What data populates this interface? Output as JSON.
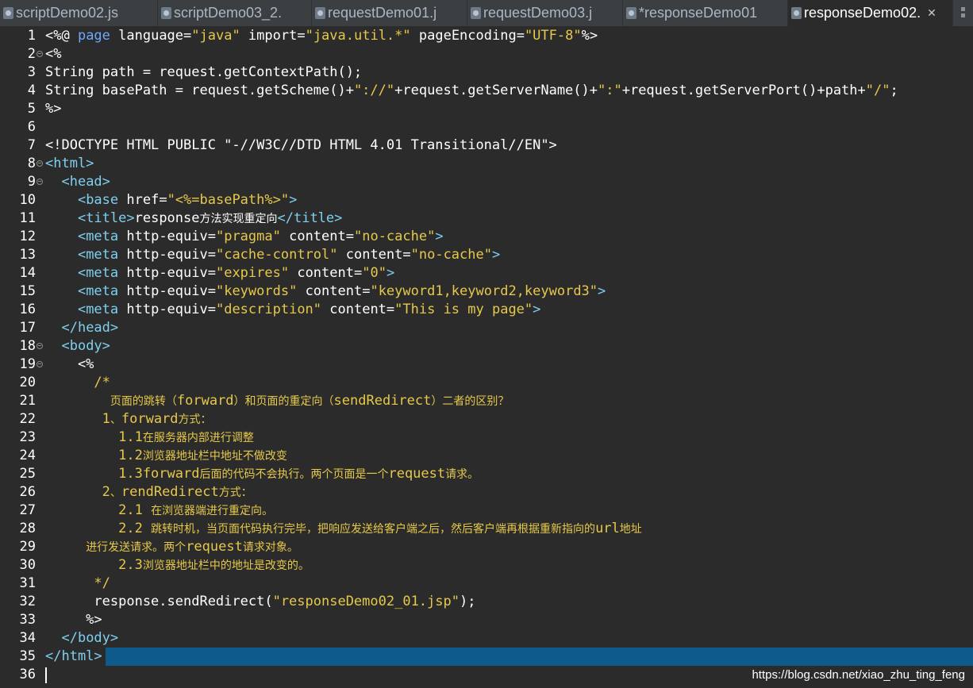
{
  "tabs": [
    {
      "label": "scriptDemo02.js",
      "active": false
    },
    {
      "label": "scriptDemo03_2.",
      "active": false
    },
    {
      "label": "requestDemo01.j",
      "active": false
    },
    {
      "label": "requestDemo03.j",
      "active": false
    },
    {
      "label": "*responseDemo01",
      "active": false
    },
    {
      "label": "responseDemo02.",
      "active": true
    }
  ],
  "close_symbol": "✕",
  "lines": [
    {
      "n": "1",
      "fold": false,
      "segs": [
        [
          "def",
          "<%@ "
        ],
        [
          "kw",
          "page"
        ],
        [
          "def",
          " language="
        ],
        [
          "str",
          "\"java\""
        ],
        [
          "def",
          " import="
        ],
        [
          "str",
          "\"java.util.*\""
        ],
        [
          "def",
          " pageEncoding="
        ],
        [
          "str",
          "\"UTF-8\""
        ],
        [
          "def",
          "%>"
        ]
      ]
    },
    {
      "n": "2",
      "fold": true,
      "segs": [
        [
          "def",
          "<%"
        ]
      ]
    },
    {
      "n": "3",
      "fold": false,
      "segs": [
        [
          "def",
          "String path = request.getContextPath();"
        ]
      ]
    },
    {
      "n": "4",
      "fold": false,
      "segs": [
        [
          "def",
          "String basePath = request.getScheme()+"
        ],
        [
          "str",
          "\"://\""
        ],
        [
          "def",
          "+request.getServerName()+"
        ],
        [
          "str",
          "\":\""
        ],
        [
          "def",
          "+request.getServerPort()+path+"
        ],
        [
          "str",
          "\"/\""
        ],
        [
          "def",
          ";"
        ]
      ]
    },
    {
      "n": "5",
      "fold": false,
      "segs": [
        [
          "def",
          "%>"
        ]
      ]
    },
    {
      "n": "6",
      "fold": false,
      "segs": []
    },
    {
      "n": "7",
      "fold": false,
      "segs": [
        [
          "def",
          "<!DOCTYPE HTML PUBLIC \"-//W3C//DTD HTML 4.01 Transitional//EN\">"
        ]
      ]
    },
    {
      "n": "8",
      "fold": true,
      "segs": [
        [
          "tag",
          "<html>"
        ]
      ]
    },
    {
      "n": "9",
      "fold": true,
      "segs": [
        [
          "def",
          "  "
        ],
        [
          "tag",
          "<head>"
        ]
      ]
    },
    {
      "n": "10",
      "fold": false,
      "segs": [
        [
          "def",
          "    "
        ],
        [
          "tag",
          "<base"
        ],
        [
          "attr",
          " href="
        ],
        [
          "str",
          "\"<%=basePath%>\""
        ],
        [
          "tag",
          ">"
        ]
      ]
    },
    {
      "n": "11",
      "fold": false,
      "segs": [
        [
          "def",
          "    "
        ],
        [
          "tag",
          "<title>"
        ],
        [
          "def",
          "response"
        ],
        [
          "cjk",
          "方法实现重定向"
        ],
        [
          "tag",
          "</title>"
        ]
      ]
    },
    {
      "n": "12",
      "fold": false,
      "segs": [
        [
          "def",
          "    "
        ],
        [
          "tag",
          "<meta"
        ],
        [
          "attr",
          " http-equiv="
        ],
        [
          "str",
          "\"pragma\""
        ],
        [
          "attr",
          " content="
        ],
        [
          "str",
          "\"no-cache\""
        ],
        [
          "tag",
          ">"
        ]
      ]
    },
    {
      "n": "13",
      "fold": false,
      "segs": [
        [
          "def",
          "    "
        ],
        [
          "tag",
          "<meta"
        ],
        [
          "attr",
          " http-equiv="
        ],
        [
          "str",
          "\"cache-control\""
        ],
        [
          "attr",
          " content="
        ],
        [
          "str",
          "\"no-cache\""
        ],
        [
          "tag",
          ">"
        ]
      ]
    },
    {
      "n": "14",
      "fold": false,
      "segs": [
        [
          "def",
          "    "
        ],
        [
          "tag",
          "<meta"
        ],
        [
          "attr",
          " http-equiv="
        ],
        [
          "str",
          "\"expires\""
        ],
        [
          "attr",
          " content="
        ],
        [
          "str",
          "\"0\""
        ],
        [
          "tag",
          ">"
        ]
      ]
    },
    {
      "n": "15",
      "fold": false,
      "segs": [
        [
          "def",
          "    "
        ],
        [
          "tag",
          "<meta"
        ],
        [
          "attr",
          " http-equiv="
        ],
        [
          "str",
          "\"keywords\""
        ],
        [
          "attr",
          " content="
        ],
        [
          "str",
          "\"keyword1,keyword2,keyword3\""
        ],
        [
          "tag",
          ">"
        ]
      ]
    },
    {
      "n": "16",
      "fold": false,
      "segs": [
        [
          "def",
          "    "
        ],
        [
          "tag",
          "<meta"
        ],
        [
          "attr",
          " http-equiv="
        ],
        [
          "str",
          "\"description\""
        ],
        [
          "attr",
          " content="
        ],
        [
          "str",
          "\"This is my page\""
        ],
        [
          "tag",
          ">"
        ]
      ]
    },
    {
      "n": "17",
      "fold": false,
      "segs": [
        [
          "def",
          "  "
        ],
        [
          "tag",
          "</head>"
        ]
      ]
    },
    {
      "n": "18",
      "fold": true,
      "segs": [
        [
          "def",
          "  "
        ],
        [
          "tag",
          "<body>"
        ]
      ]
    },
    {
      "n": "19",
      "fold": true,
      "segs": [
        [
          "def",
          "    <%"
        ]
      ]
    },
    {
      "n": "20",
      "fold": false,
      "segs": [
        [
          "cmt",
          "      /*"
        ]
      ]
    },
    {
      "n": "21",
      "fold": false,
      "segs": [
        [
          "cmt",
          "        "
        ],
        [
          "cmtcjk",
          "页面的跳转（"
        ],
        [
          "cmt",
          "forward"
        ],
        [
          "cmtcjk",
          "）和页面的重定向（"
        ],
        [
          "cmt",
          "sendRedirect"
        ],
        [
          "cmtcjk",
          "）二者的区别？"
        ]
      ]
    },
    {
      "n": "22",
      "fold": false,
      "segs": [
        [
          "cmt",
          "       1"
        ],
        [
          "cmtcjk",
          "、"
        ],
        [
          "cmt",
          "forward"
        ],
        [
          "cmtcjk",
          "方式："
        ]
      ]
    },
    {
      "n": "23",
      "fold": false,
      "segs": [
        [
          "cmt",
          "         1.1"
        ],
        [
          "cmtcjk",
          "在服务器内部进行调整"
        ]
      ]
    },
    {
      "n": "24",
      "fold": false,
      "segs": [
        [
          "cmt",
          "         1.2"
        ],
        [
          "cmtcjk",
          "浏览器地址栏中地址不做改变"
        ]
      ]
    },
    {
      "n": "25",
      "fold": false,
      "segs": [
        [
          "cmt",
          "         1.3forward"
        ],
        [
          "cmtcjk",
          "后面的代码不会执行。两个页面是一个"
        ],
        [
          "cmt",
          "request"
        ],
        [
          "cmtcjk",
          "请求。"
        ]
      ]
    },
    {
      "n": "26",
      "fold": false,
      "segs": [
        [
          "cmt",
          "       2"
        ],
        [
          "cmtcjk",
          "、"
        ],
        [
          "cmt",
          "rendRedirect"
        ],
        [
          "cmtcjk",
          "方式："
        ]
      ]
    },
    {
      "n": "27",
      "fold": false,
      "segs": [
        [
          "cmt",
          "         2.1 "
        ],
        [
          "cmtcjk",
          "在浏览器端进行重定向。"
        ]
      ]
    },
    {
      "n": "28",
      "fold": false,
      "segs": [
        [
          "cmt",
          "         2.2 "
        ],
        [
          "cmtcjk",
          "跳转时机，当页面代码执行完毕，把响应发送给客户端之后，然后客户端再根据重新指向的"
        ],
        [
          "cmt",
          "url"
        ],
        [
          "cmtcjk",
          "地址"
        ]
      ]
    },
    {
      "n": "29",
      "fold": false,
      "segs": [
        [
          "cmt",
          "     "
        ],
        [
          "cmtcjk",
          "进行发送请求。两个"
        ],
        [
          "cmt",
          "request"
        ],
        [
          "cmtcjk",
          "请求对象。"
        ]
      ]
    },
    {
      "n": "30",
      "fold": false,
      "segs": [
        [
          "cmt",
          "         2.3"
        ],
        [
          "cmtcjk",
          "浏览器地址栏中的地址是改变的。"
        ]
      ]
    },
    {
      "n": "31",
      "fold": false,
      "segs": [
        [
          "cmt",
          "      */"
        ]
      ]
    },
    {
      "n": "32",
      "fold": false,
      "segs": [
        [
          "def",
          "      response.sendRedirect("
        ],
        [
          "str",
          "\"responseDemo02_01.jsp\""
        ],
        [
          "def",
          ");"
        ]
      ]
    },
    {
      "n": "33",
      "fold": false,
      "segs": [
        [
          "def",
          "     %>"
        ]
      ]
    },
    {
      "n": "34",
      "fold": false,
      "segs": [
        [
          "def",
          "  "
        ],
        [
          "tag",
          "</body>"
        ]
      ]
    },
    {
      "n": "35",
      "fold": false,
      "segs": [
        [
          "tag",
          "</html>"
        ]
      ]
    },
    {
      "n": "36",
      "fold": false,
      "segs": []
    }
  ],
  "selected_line": "35",
  "caret_line": "36",
  "watermark": "https://blog.csdn.net/xiao_zhu_ting_feng",
  "colors": {
    "string": "#e6c84a",
    "tag": "#7fd0f0",
    "keyword": "#6fa8ff",
    "selection": "#0e5a8a"
  }
}
